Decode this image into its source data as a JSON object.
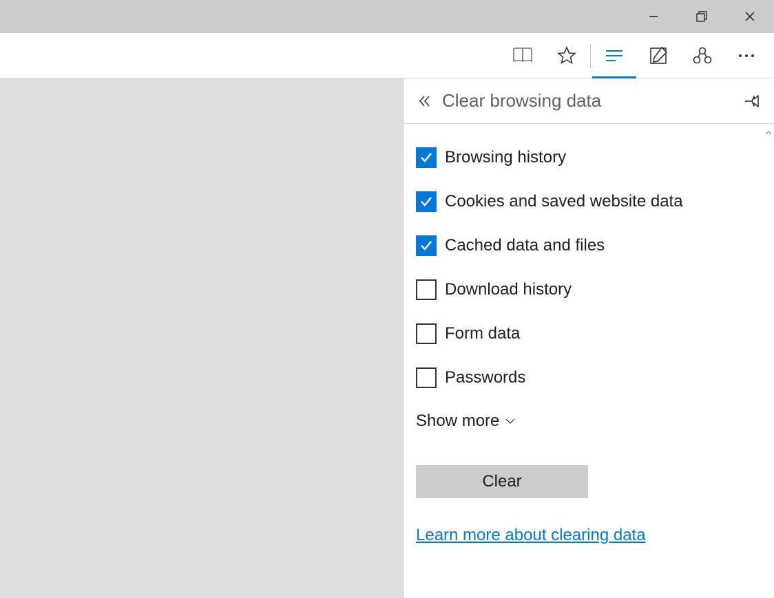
{
  "panel": {
    "title": "Clear browsing data",
    "items": [
      {
        "label": "Browsing history",
        "checked": true
      },
      {
        "label": "Cookies and saved website data",
        "checked": true
      },
      {
        "label": "Cached data and files",
        "checked": true
      },
      {
        "label": "Download history",
        "checked": false
      },
      {
        "label": "Form data",
        "checked": false
      },
      {
        "label": "Passwords",
        "checked": false
      }
    ],
    "show_more": "Show more",
    "clear_button": "Clear",
    "learn_link": "Learn more about clearing data"
  }
}
